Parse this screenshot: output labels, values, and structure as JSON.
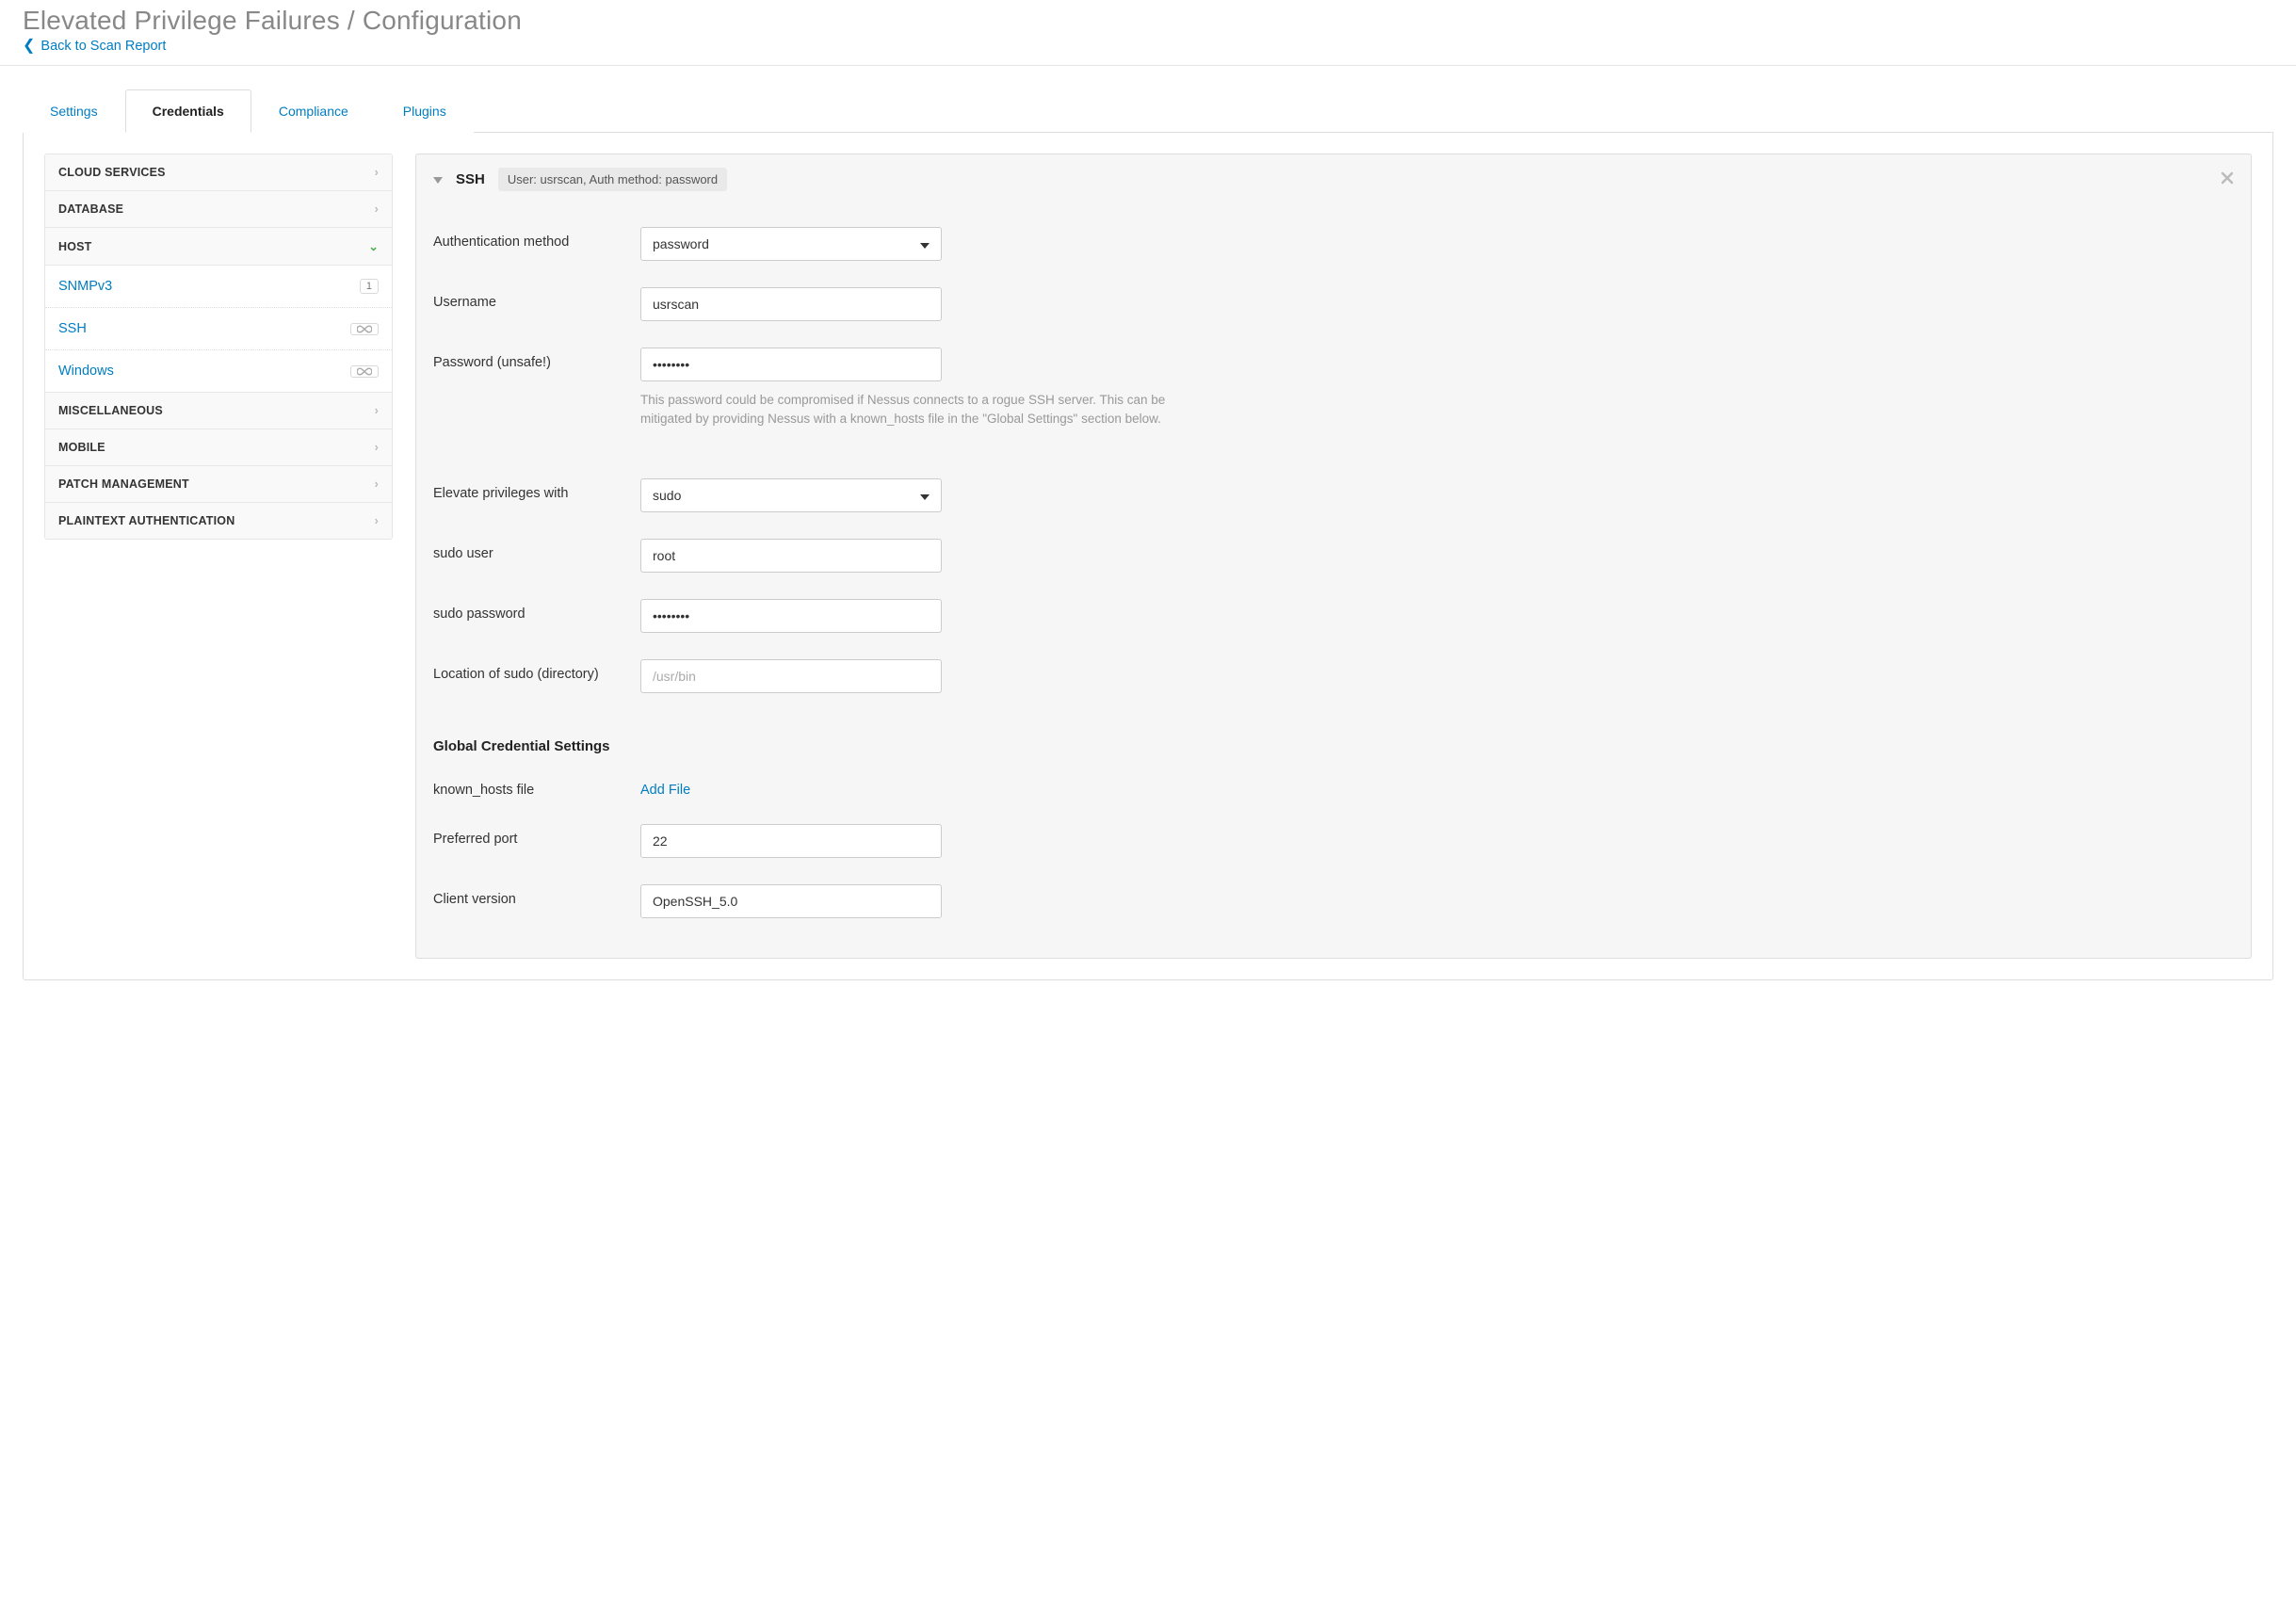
{
  "header": {
    "title": "Elevated Privilege Failures / Configuration",
    "back_label": "Back to Scan Report"
  },
  "tabs": [
    {
      "label": "Settings",
      "active": false
    },
    {
      "label": "Credentials",
      "active": true
    },
    {
      "label": "Compliance",
      "active": false
    },
    {
      "label": "Plugins",
      "active": false
    }
  ],
  "sidebar": {
    "categories": [
      {
        "label": "CLOUD SERVICES",
        "expanded": false
      },
      {
        "label": "DATABASE",
        "expanded": false
      },
      {
        "label": "HOST",
        "expanded": true,
        "items": [
          {
            "label": "SNMPv3",
            "badge_type": "count",
            "badge": "1"
          },
          {
            "label": "SSH",
            "badge_type": "inf"
          },
          {
            "label": "Windows",
            "badge_type": "inf"
          }
        ]
      },
      {
        "label": "MISCELLANEOUS",
        "expanded": false
      },
      {
        "label": "MOBILE",
        "expanded": false
      },
      {
        "label": "PATCH MANAGEMENT",
        "expanded": false
      },
      {
        "label": "PLAINTEXT AUTHENTICATION",
        "expanded": false
      }
    ]
  },
  "card": {
    "title": "SSH",
    "summary": "User: usrscan, Auth method: password"
  },
  "form": {
    "auth_method": {
      "label": "Authentication method",
      "value": "password"
    },
    "username": {
      "label": "Username",
      "value": "usrscan"
    },
    "password": {
      "label": "Password (unsafe!)",
      "value": "••••••••",
      "help": "This password could be compromised if Nessus connects to a rogue SSH server. This can be mitigated by providing Nessus with a known_hosts file in the \"Global Settings\" section below."
    },
    "elevate": {
      "label": "Elevate privileges with",
      "value": "sudo"
    },
    "sudo_user": {
      "label": "sudo user",
      "value": "root"
    },
    "sudo_password": {
      "label": "sudo password",
      "value": "••••••••"
    },
    "sudo_location": {
      "label": "Location of sudo (directory)",
      "placeholder": "/usr/bin",
      "value": ""
    },
    "section_title": "Global Credential Settings",
    "known_hosts": {
      "label": "known_hosts file",
      "action": "Add File"
    },
    "preferred_port": {
      "label": "Preferred port",
      "value": "22"
    },
    "client_version": {
      "label": "Client version",
      "value": "OpenSSH_5.0"
    }
  }
}
